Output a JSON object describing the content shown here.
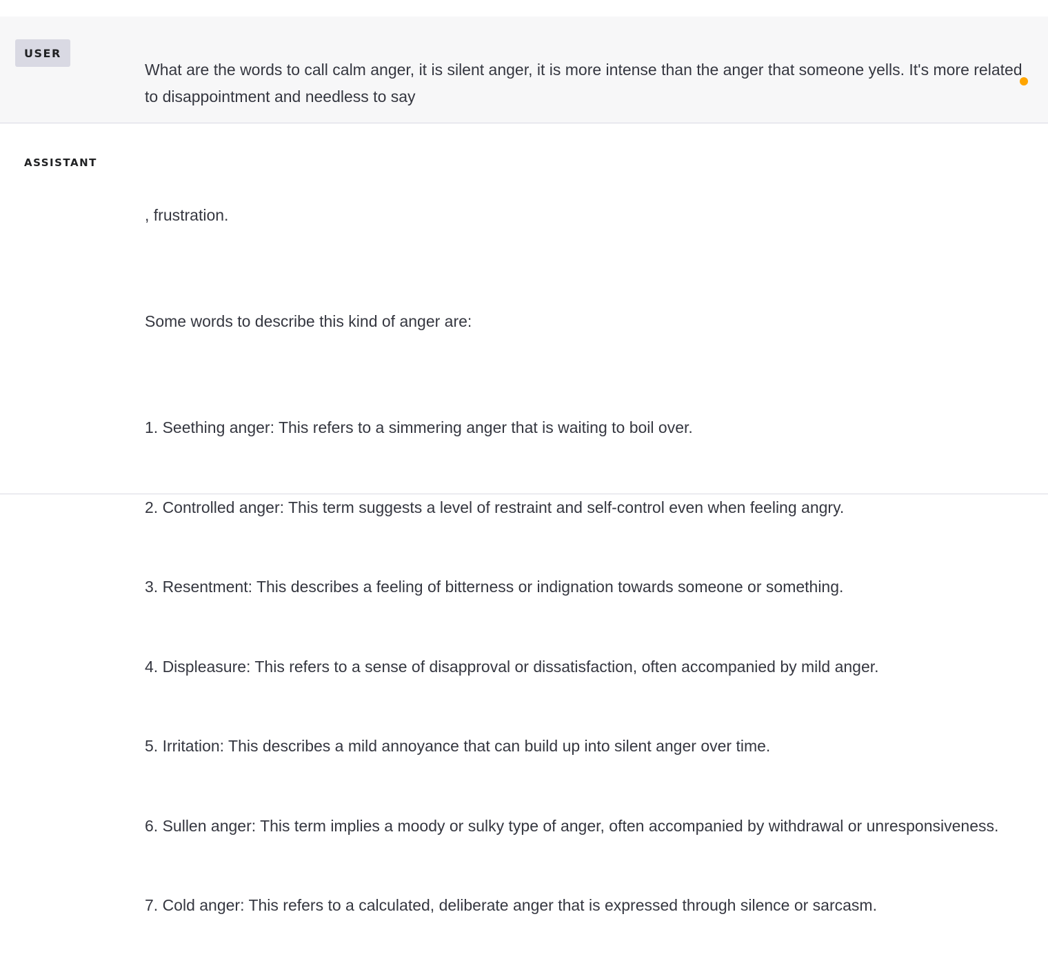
{
  "conversation": {
    "user": {
      "role_label": "USER",
      "text": "What are the words to call calm anger, it is silent anger, it is more intense than the anger that someone yells. It's more related to disappointment and needless to say",
      "status_color": "#ffa500"
    },
    "assistant": {
      "role_label": "ASSISTANT",
      "intro": ", frustration.",
      "lead": "Some words to describe this kind of anger are:",
      "items": [
        "1. Seething anger: This refers to a simmering anger that is waiting to boil over.",
        "2. Controlled anger: This term suggests a level of restraint and self-control even when feeling angry.",
        "3. Resentment: This describes a feeling of bitterness or indignation towards someone or something.",
        "4. Displeasure: This refers to a sense of disapproval or dissatisfaction, often accompanied by mild anger.",
        "5. Irritation: This describes a mild annoyance that can build up into silent anger over time.",
        "6. Sullen anger: This term implies a moody or sulky type of anger, often accompanied by withdrawal or unresponsiveness.",
        "7. Cold anger: This refers to a calculated, deliberate anger that is expressed through silence or sarcasm."
      ]
    }
  }
}
